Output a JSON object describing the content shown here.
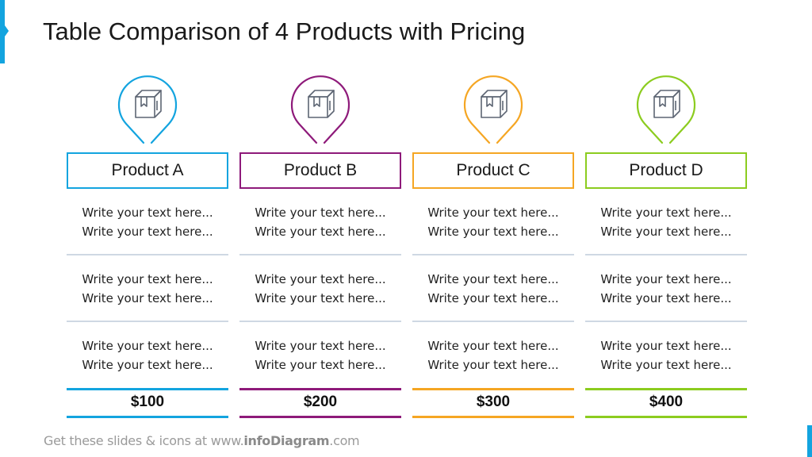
{
  "slide": {
    "title": "Table Comparison of 4 Products with Pricing",
    "accent_color": "#13a4df"
  },
  "products": [
    {
      "name": "Product A",
      "color": "#13a4df",
      "icon": "box-package-icon",
      "rows": [
        [
          "Write your text here...",
          "Write your text here..."
        ],
        [
          "Write your text here...",
          "Write your text here..."
        ],
        [
          "Write your text here...",
          "Write your text here..."
        ]
      ],
      "price": "$100"
    },
    {
      "name": "Product B",
      "color": "#8e1a7a",
      "icon": "box-package-icon",
      "rows": [
        [
          "Write your text here...",
          "Write your text here..."
        ],
        [
          "Write your text here...",
          "Write your text here..."
        ],
        [
          "Write your text here...",
          "Write your text here..."
        ]
      ],
      "price": "$200"
    },
    {
      "name": "Product C",
      "color": "#f5a623",
      "icon": "box-package-icon",
      "rows": [
        [
          "Write your text here...",
          "Write your text here..."
        ],
        [
          "Write your text here...",
          "Write your text here..."
        ],
        [
          "Write your text here...",
          "Write your text here..."
        ]
      ],
      "price": "$300"
    },
    {
      "name": "Product D",
      "color": "#8ccc1f",
      "icon": "box-package-icon",
      "rows": [
        [
          "Write your text here...",
          "Write your text here..."
        ],
        [
          "Write your text here...",
          "Write your text here..."
        ],
        [
          "Write your text here...",
          "Write your text here..."
        ]
      ],
      "price": "$400"
    }
  ],
  "footer": {
    "prefix": "Get these slides & icons at www.",
    "brand": "infoDiagram",
    "suffix": ".com"
  }
}
